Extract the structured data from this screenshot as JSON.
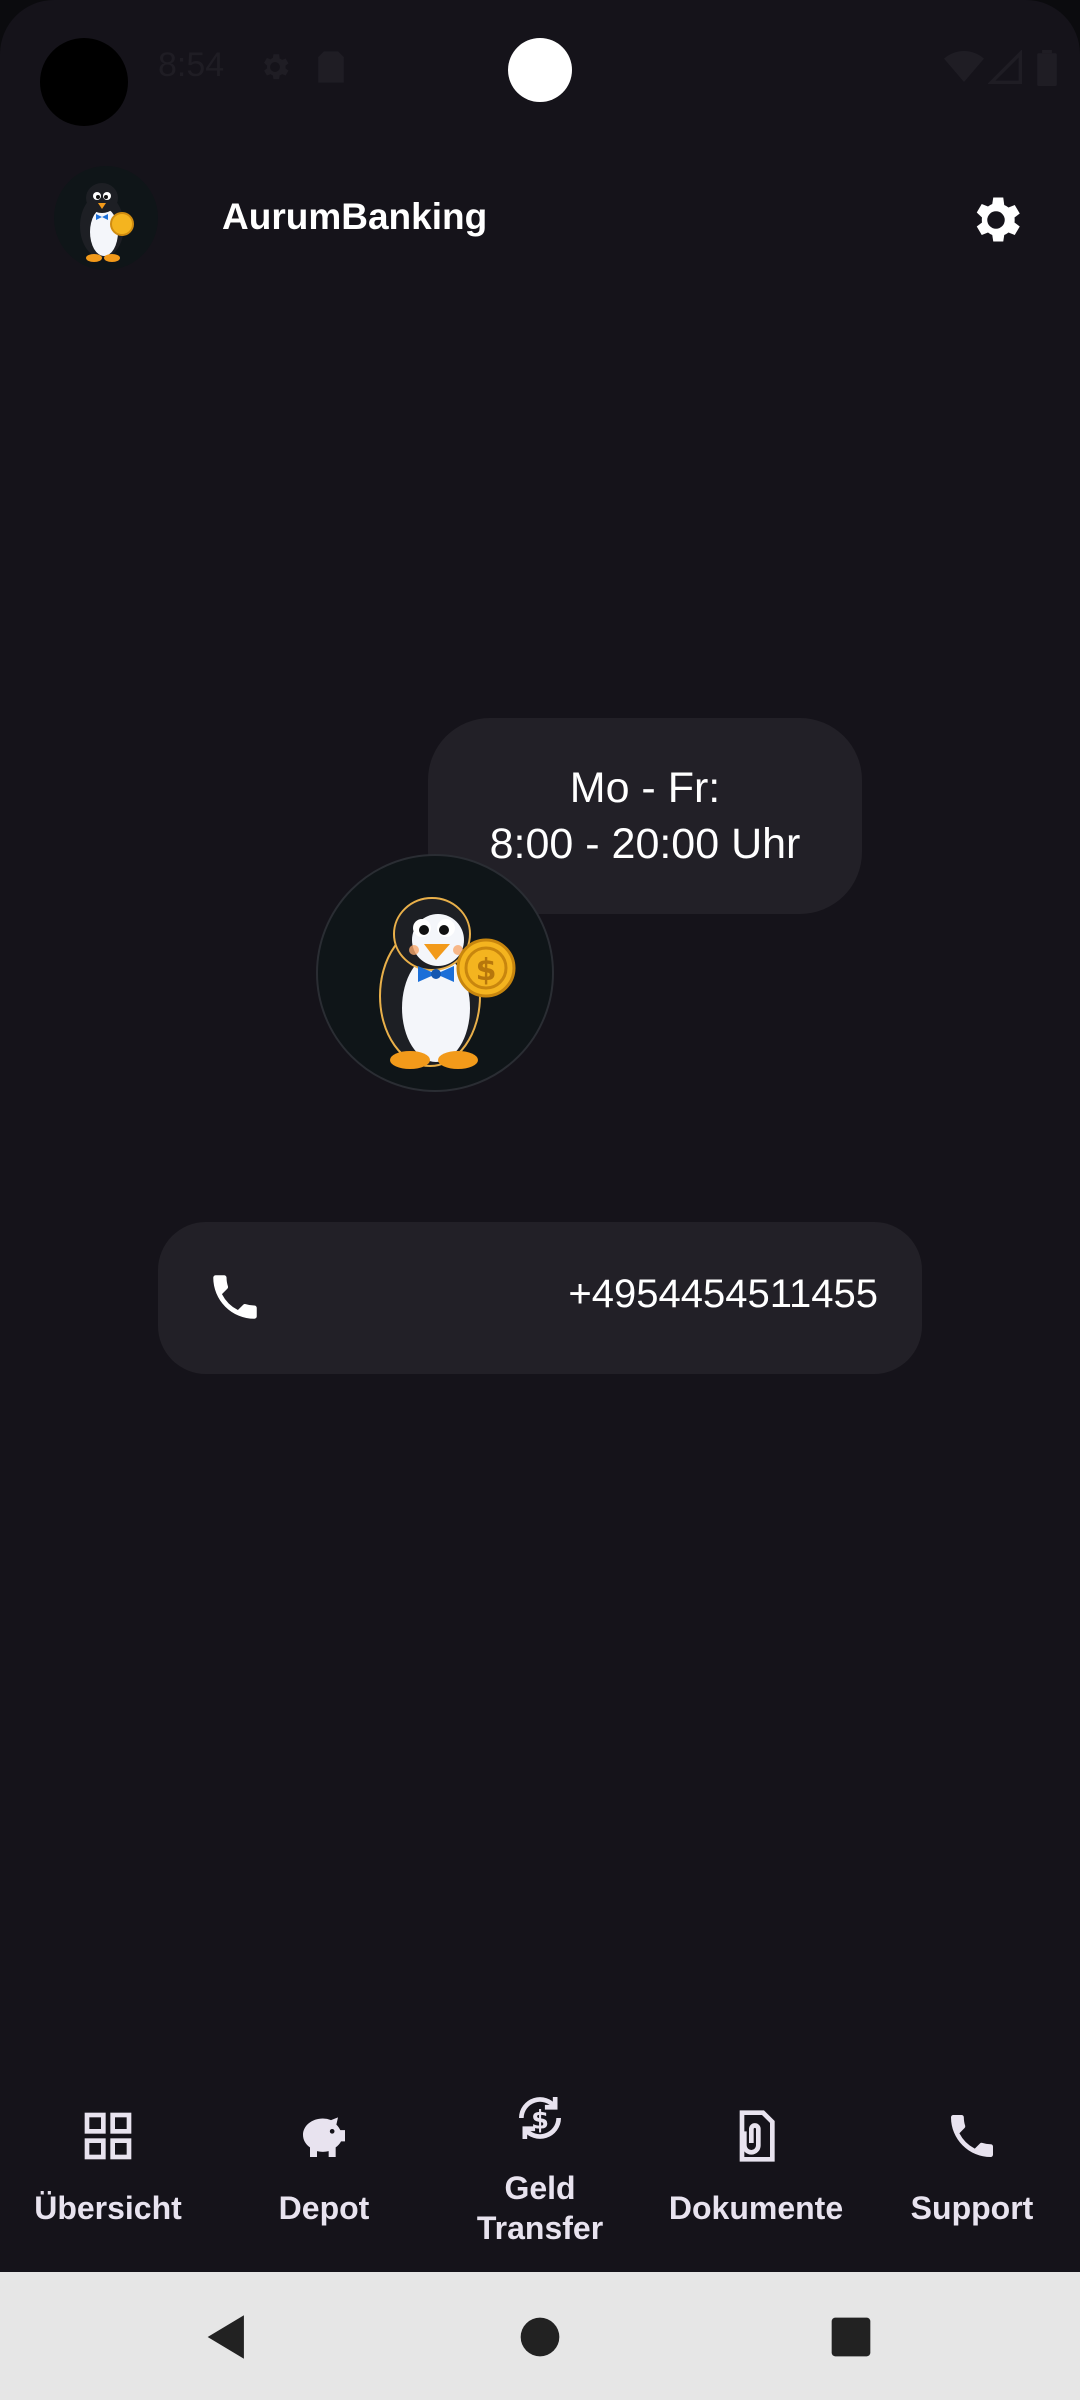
{
  "status_bar": {
    "time": "8:54",
    "icons": [
      "gear-icon",
      "sim-card-icon",
      "wifi-icon",
      "cellular-signal-icon",
      "battery-icon"
    ]
  },
  "app_bar": {
    "title": "AurumBanking",
    "logo_icon": "penguin-mascot-icon",
    "settings_icon": "gear-icon"
  },
  "support": {
    "hours_line1": "Mo - Fr:",
    "hours_line2": "8:00 - 20:00 Uhr",
    "mascot_icon": "penguin-mascot-icon",
    "phone_icon": "phone-icon",
    "phone_number": "+4954454511455"
  },
  "bottom_nav": {
    "items": [
      {
        "label": "Übersicht",
        "icon": "grid-icon"
      },
      {
        "label": "Depot",
        "icon": "piggy-bank-icon"
      },
      {
        "label_line1": "Geld",
        "label_line2": "Transfer",
        "icon": "money-transfer-icon"
      },
      {
        "label": "Dokumente",
        "icon": "attachment-document-icon"
      },
      {
        "label": "Support",
        "icon": "phone-icon"
      }
    ]
  },
  "system_nav": {
    "icons": [
      "back-triangle-icon",
      "home-circle-icon",
      "recents-square-icon"
    ]
  },
  "colors": {
    "background": "#15131a",
    "card": "#222027",
    "text": "#ffffff",
    "nav_text": "#e8e3ef",
    "system_nav": "#e6e6e6"
  }
}
